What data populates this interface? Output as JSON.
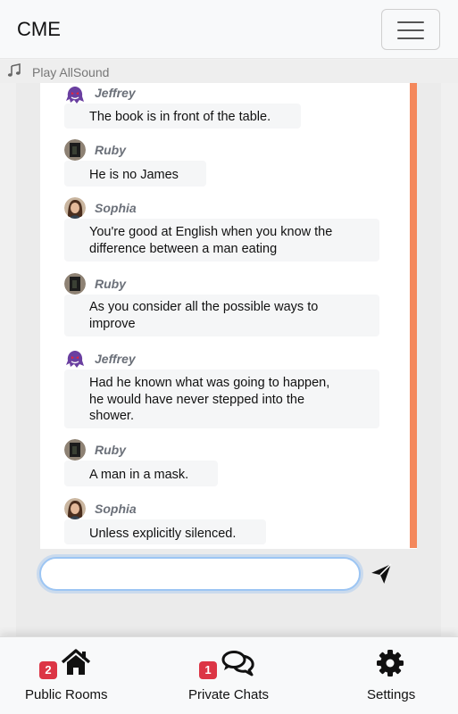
{
  "app": {
    "brand": "CME"
  },
  "sound": {
    "label": "Play AllSound",
    "icon": "music-note-icon"
  },
  "messages": [
    {
      "author": "Jeffrey",
      "avatar": "ghost-avatar",
      "lines": [
        "The book is in front of the table."
      ]
    },
    {
      "author": "Ruby",
      "avatar": "dark-photo-avatar",
      "lines": [
        "He is no James"
      ]
    },
    {
      "author": "Sophia",
      "avatar": "portrait-avatar",
      "lines": [
        "You're good at English when you know the",
        "difference between a man eating"
      ]
    },
    {
      "author": "Ruby",
      "avatar": "dark-photo-avatar",
      "lines": [
        "As you consider all the possible ways to",
        "improve"
      ]
    },
    {
      "author": "Jeffrey",
      "avatar": "ghost-avatar",
      "lines": [
        "Had he known what was going to happen,",
        "he would have never stepped into the",
        "shower."
      ]
    },
    {
      "author": "Ruby",
      "avatar": "dark-photo-avatar",
      "lines": [
        "A man in a mask."
      ]
    },
    {
      "author": "Sophia",
      "avatar": "portrait-avatar",
      "lines": [
        "Unless explicitly silenced."
      ]
    }
  ],
  "composer": {
    "value": "",
    "placeholder": ""
  },
  "nav": [
    {
      "label": "Public Rooms",
      "badge": "2",
      "icon": "home-icon"
    },
    {
      "label": "Private Chats",
      "badge": "1",
      "icon": "chat-bubbles-icon"
    },
    {
      "label": "Settings",
      "badge": "",
      "icon": "gear-icon"
    }
  ],
  "colors": {
    "accent": "#f4885c",
    "badge": "#dc3545",
    "focus": "#9cc5f3"
  }
}
